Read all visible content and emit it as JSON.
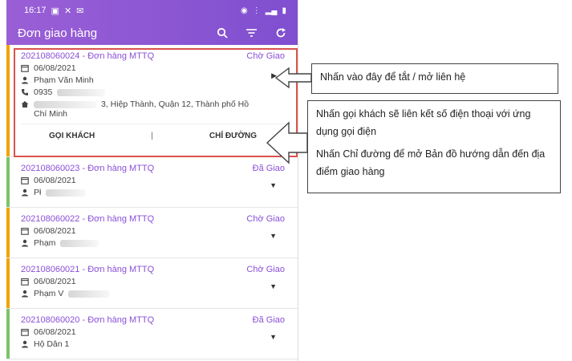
{
  "status_bar": {
    "time": "16:17"
  },
  "app_bar": {
    "title": "Đơn giao hàng",
    "icons": [
      "search-icon",
      "filter-icon",
      "refresh-icon"
    ]
  },
  "orders": [
    {
      "code": "202108060024 - Đơn hàng MTTQ",
      "status": "Chờ Giao",
      "date": "06/08/2021",
      "name": "Phạm Văn Minh",
      "phone": "0935",
      "address_visible": "3, Hiệp Thành, Quận 12, Thành phố Hồ",
      "address_line2": "Chí Minh",
      "expanded": true
    },
    {
      "code": "202108060023 - Đơn hàng MTTQ",
      "status": "Đã Giao",
      "date": "06/08/2021",
      "name": "Pł"
    },
    {
      "code": "202108060022 - Đơn hàng MTTQ",
      "status": "Chờ Giao",
      "date": "06/08/2021",
      "name": "Phạm"
    },
    {
      "code": "202108060021 - Đơn hàng MTTQ",
      "status": "Chờ Giao",
      "date": "06/08/2021",
      "name": "Phạm V"
    },
    {
      "code": "202108060020 - Đơn hàng MTTQ",
      "status": "Đã Giao",
      "date": "06/08/2021",
      "name": "Hộ Dân 1"
    }
  ],
  "actions": {
    "call": "GỌI KHÁCH",
    "separator": "|",
    "directions": "CHỈ ĐƯỜNG"
  },
  "callouts": {
    "toggle": "Nhấn vào đây để tắt / mở liên hệ",
    "call": "Nhấn gọi khách sẽ liên kết số điện thoại với ứng dụng gọi điện",
    "directions": "Nhấn Chỉ đường để mở Bản đồ hướng dẫn đến địa điểm giao hàng"
  },
  "colors": {
    "accent": "#8a4fd8",
    "highlight": "#d9534f",
    "pending_bar": "#f0a300",
    "done_bar": "#7cc36a"
  }
}
